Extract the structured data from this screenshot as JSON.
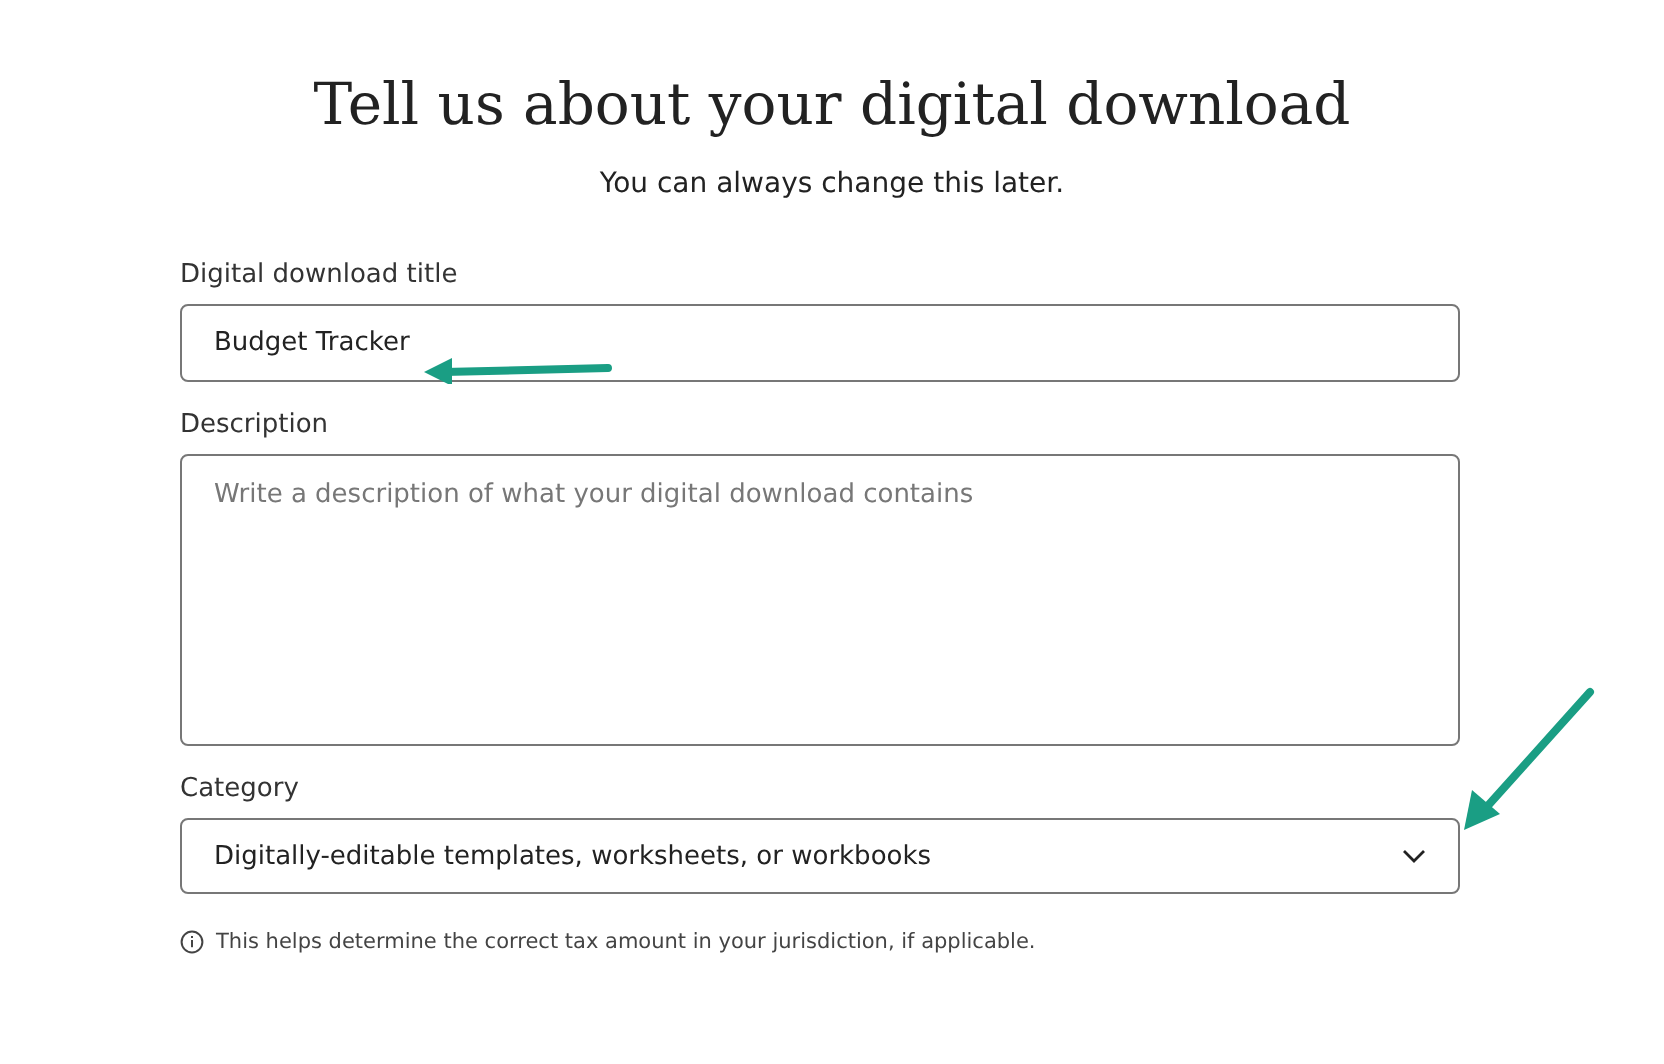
{
  "heading": "Tell us about your digital download",
  "subheading": "You can always change this later.",
  "fields": [
    {
      "kind": "text",
      "label": "Digital download title",
      "value": "Budget Tracker"
    },
    {
      "kind": "textarea",
      "label": "Description",
      "placeholder": "Write a description of what your digital download contains"
    },
    {
      "kind": "select",
      "label": "Category",
      "value": "Digitally-editable templates, worksheets, or workbooks"
    }
  ],
  "hint": "This helps determine the correct tax amount in your jurisdiction, if applicable."
}
